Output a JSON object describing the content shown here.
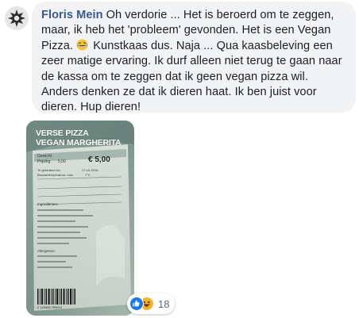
{
  "comment": {
    "author": "Floris Mein",
    "text_part1": "Oh verdorie ... Het is beroerd om te zeggen, maar, ik heb het 'probleem' gevonden. Het is een Vegan Pizza. ",
    "text_part2": " Kunstkaas dus. Naja ... Qua kaasbeleving een zeer matige ervaring. Ik durf alleen niet terug te gaan naar de kassa om te zeggen dat ik geen vegan pizza wil. Anders denken ze dat ik dieren haat. Ik ben juist voor dieren. Hup dieren!",
    "emoji_icon": "laughing-emoji-icon"
  },
  "photo": {
    "label_line1": "VERSE PIZZA",
    "label_line2": "VEGAN MARGHERITA",
    "price": "€ 5,00",
    "weight_label": "Gewicht",
    "unit_price_label": "Prijs/kg",
    "unit_price_value": "5,00",
    "use_by_label": "Te gebruiken tot:",
    "use_by_value": "17-10-2018",
    "storage_label": "Bewaartemperatuur: max",
    "storage_value": "7°C",
    "ingredients_label": "Ingrediënten:",
    "allergens_label": "Allergenen:",
    "barcode_digits": "2 123456 789012"
  },
  "reactions": {
    "count": "18",
    "icons": [
      "like-icon",
      "haha-icon"
    ],
    "like_color": "#1877f2",
    "haha_color": "#f7b125"
  },
  "colors": {
    "author": "#385898",
    "bubble_bg": "#f2f3f5",
    "text": "#1c1e21"
  }
}
